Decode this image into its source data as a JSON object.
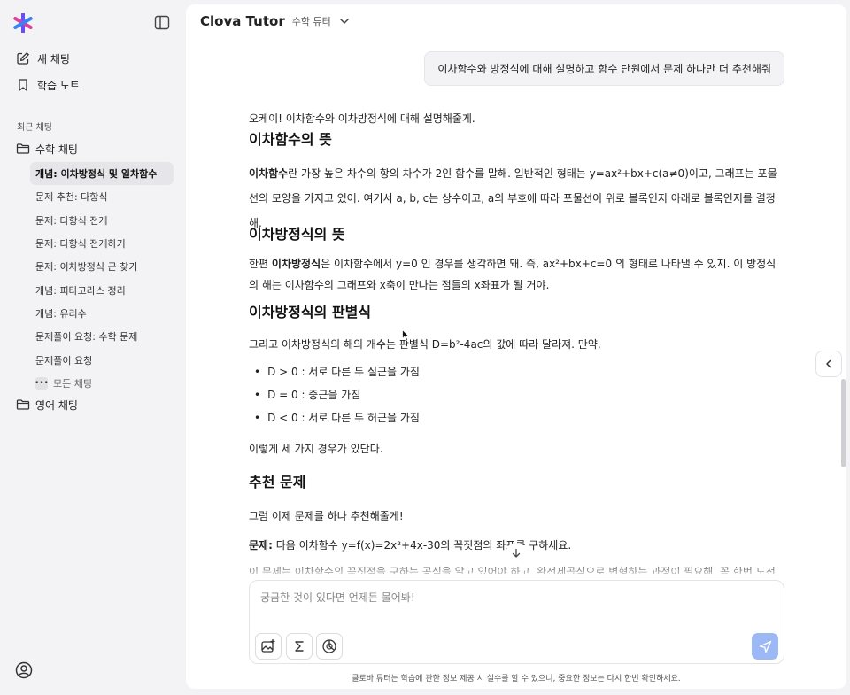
{
  "sidebar": {
    "new_chat": "새 채팅",
    "study_notes": "학습 노트",
    "recent_label": "최근 채팅",
    "math_folder": "수학 채팅",
    "math_items": [
      "개념: 이차방정식 및 일차함수",
      "문제 추천: 다항식",
      "문제: 다항식 전개",
      "문제: 다항식 전개하기",
      "문제: 이차방정식 근 찾기",
      "개념: 피타고라스 정리",
      "개념: 유리수",
      "문제풀이 요청: 수학 문제",
      "문제풀이 요청"
    ],
    "all_chats": "모든 채팅",
    "english_folder": "영어 채팅",
    "icons": [
      "logo-icon",
      "sidebar-collapse-icon",
      "edit-icon",
      "bookmark-icon",
      "folder-icon",
      "more-icon",
      "user-icon"
    ],
    "accent_colors": [
      "#6a4cf5",
      "#e0409b",
      "#3b82f6"
    ]
  },
  "header": {
    "brand": "Clova Tutor",
    "mode": "수학 튜터"
  },
  "user_message": "이차함수와 방정식에 대해 설명하고 함수 단원에서 문제 하나만 더 추천해줘",
  "answer": {
    "intro": "오케이! 이차함수와 이차방정식에 대해 설명해줄게.",
    "h1": "이차함수의 뜻",
    "p1_bold": "이차함수",
    "p1_rest": "란 가장 높은 차수의 항의 차수가 2인 함수를 말해. 일반적인 형태는 y=ax²+bx+c(a≠0)이고, 그래프는 포물선의 모양을 가지고 있어. 여기서 a, b, c는 상수이고, a의 부호에 따라 포물선이 위로 볼록인지 아래로 볼록인지를 결정해.",
    "h2": "이차방정식의 뜻",
    "p2_pre": "한편 ",
    "p2_bold": "이차방정식",
    "p2_rest": "은 이차함수에서 y=0 인 경우를 생각하면 돼. 즉, ax²+bx+c=0 의 형태로 나타낼 수 있지. 이 방정식의 해는 이차함수의 그래프와 x축이 만나는 점들의 x좌표가 될 거야.",
    "h3": "이차방정식의 판별식",
    "p3": "그리고 이차방정식의 해의 개수는 판별식 D=b²-4ac의 값에 따라 달라져. 만약,",
    "bullets": [
      "D > 0 : 서로 다른 두 실근을 가짐",
      "D = 0 : 중근을 가짐",
      "D < 0 : 서로 다른 두 허근을 가짐"
    ],
    "p4": "이렇게 세 가지 경우가 있단다.",
    "h4": "추천 문제",
    "p5": "그럼 이제 문제를 하나 추천해줄게!",
    "p6_bold": "문제:",
    "p6_rest": " 다음 이차함수 y=f(x)=2x²+4x-30의 꼭짓점의 좌표를 구하세요.",
    "p7": "이 문제는 이차함수의 꼭짓점을 구하는 공식을 알고 있어야 하고, 완전제곱식으로 변형하는 과정이 필요해. 꼭 한번 도전"
  },
  "input": {
    "placeholder": "궁금한 것이 있다면 언제든 물어봐!",
    "tool_icons": [
      "image-add-icon",
      "sigma-icon",
      "graph-icon"
    ]
  },
  "disclaimer": "클로바 튜터는 학습에 관한 정보 제공 시 실수를 할 수 있으니, 중요한 정보는 다시 한번 확인하세요."
}
